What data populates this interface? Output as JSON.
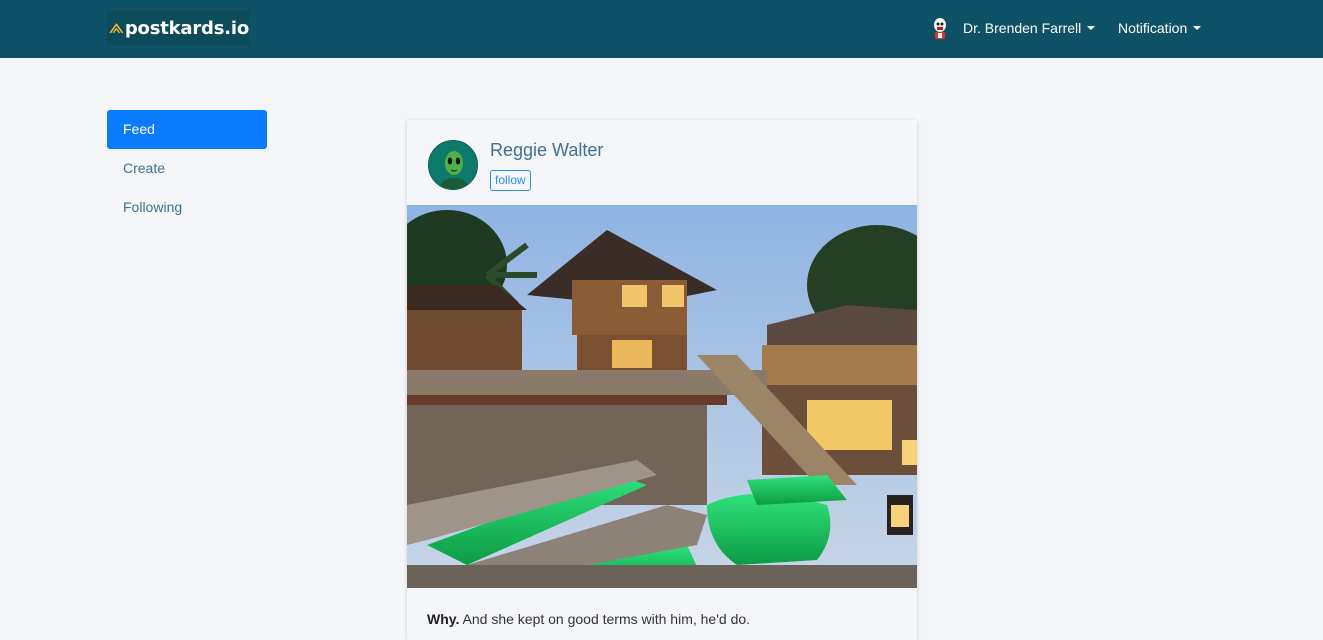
{
  "brand": {
    "name": "postkards.io",
    "logo_icon": "chevron-logo-icon"
  },
  "navbar": {
    "user_label": "Dr. Brenden Farrell",
    "notification_label": "Notification",
    "bg_color": "#0f5267"
  },
  "sidebar": {
    "items": [
      {
        "label": "Feed",
        "active": true
      },
      {
        "label": "Create",
        "active": false
      },
      {
        "label": "Following",
        "active": false
      }
    ],
    "active_color": "#0a7bff"
  },
  "post": {
    "author": "Reggie Walter",
    "follow_label": "follow",
    "caption_lead": "Why.",
    "caption_text": " And she kept on good terms with him, he'd do."
  }
}
